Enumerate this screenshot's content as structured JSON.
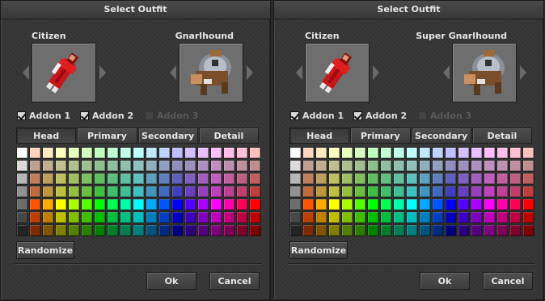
{
  "dialogs": [
    {
      "title": "Select Outfit",
      "left_name": "Citizen",
      "right_name": "Gnarlhound",
      "addons": [
        {
          "label": "Addon 1",
          "checked": true,
          "enabled": true
        },
        {
          "label": "Addon 2",
          "checked": true,
          "enabled": true
        },
        {
          "label": "Addon 3",
          "checked": false,
          "enabled": false
        }
      ],
      "tabs": [
        "Head",
        "Primary",
        "Secondary",
        "Detail"
      ],
      "active_tab": "Head",
      "randomize": "Randomize",
      "ok": "Ok",
      "cancel": "Cancel"
    },
    {
      "title": "Select Outfit",
      "left_name": "Citizen",
      "right_name": "Super Gnarlhound",
      "addons": [
        {
          "label": "Addon 1",
          "checked": true,
          "enabled": true
        },
        {
          "label": "Addon 2",
          "checked": true,
          "enabled": true
        },
        {
          "label": "Addon 3",
          "checked": false,
          "enabled": false
        }
      ],
      "tabs": [
        "Head",
        "Primary",
        "Secondary",
        "Detail"
      ],
      "active_tab": "Head",
      "randomize": "Randomize",
      "ok": "Ok",
      "cancel": "Cancel"
    }
  ],
  "palette": [
    [
      "#ffffff",
      "#ffd4bf",
      "#ffe9bf",
      "#ffffbf",
      "#e9ffbf",
      "#d4ffbf",
      "#bfffbf",
      "#bfffd4",
      "#bfffe9",
      "#bfffff",
      "#bfe9ff",
      "#bfd4ff",
      "#bfbfff",
      "#d4bfff",
      "#e9bfff",
      "#ffbfff",
      "#ffbfe9",
      "#ffbfd4",
      "#ffbfbf"
    ],
    [
      "#dadada",
      "#bf9f8f",
      "#bfaf8f",
      "#bfbf8f",
      "#afbf8f",
      "#9fbf8f",
      "#8fbf8f",
      "#8fbf9f",
      "#8fbfaf",
      "#8fbfbf",
      "#8fafbf",
      "#8f9fbf",
      "#8f8fbf",
      "#9f8fbf",
      "#af8fbf",
      "#bf8fbf",
      "#bf8faf",
      "#bf8f9f",
      "#bf8f8f"
    ],
    [
      "#b6b6b6",
      "#bf7f5f",
      "#bf9f5f",
      "#bfbf5f",
      "#9fbf5f",
      "#7fbf5f",
      "#5fbf5f",
      "#5fbf7f",
      "#5fbf9f",
      "#5fbfbf",
      "#5f9fbf",
      "#5f7fbf",
      "#5f5fbf",
      "#7f5fbf",
      "#9f5fbf",
      "#bf5fbf",
      "#bf5f9f",
      "#bf5f7f",
      "#bf5f5f"
    ],
    [
      "#919191",
      "#bf6a3f",
      "#bf953f",
      "#bfbf3f",
      "#95bf3f",
      "#6abf3f",
      "#3fbf3f",
      "#3fbf6a",
      "#3fbf95",
      "#3fbfbf",
      "#3f95bf",
      "#3f6abf",
      "#3f3fbf",
      "#6a3fbf",
      "#953fbf",
      "#bf3fbf",
      "#bf3f95",
      "#bf3f6a",
      "#bf3f3f"
    ],
    [
      "#6d6d6d",
      "#ff5500",
      "#ffaa00",
      "#ffff00",
      "#aaff00",
      "#54ff00",
      "#00ff00",
      "#00ff54",
      "#00ffaa",
      "#00ffff",
      "#00a9ff",
      "#0055ff",
      "#0000ff",
      "#5500ff",
      "#a900ff",
      "#fe00ff",
      "#ff00aa",
      "#ff0055",
      "#ff0000"
    ],
    [
      "#484848",
      "#bf3f00",
      "#bf7f00",
      "#bfbf00",
      "#7fbf00",
      "#3fbf00",
      "#00bf00",
      "#00bf3f",
      "#00bf7f",
      "#00bfbf",
      "#007fbf",
      "#003fbf",
      "#0000bf",
      "#3f00bf",
      "#7f00bf",
      "#bf00bf",
      "#bf007f",
      "#bf003f",
      "#bf0000"
    ],
    [
      "#242424",
      "#7f2a00",
      "#7f5500",
      "#7f7f00",
      "#557f00",
      "#2a7f00",
      "#007f00",
      "#007f2a",
      "#007f55",
      "#007f7f",
      "#00547f",
      "#002a7f",
      "#00007f",
      "#2a007f",
      "#54007f",
      "#7f007f",
      "#7f0055",
      "#7f002a",
      "#7f0000"
    ]
  ]
}
